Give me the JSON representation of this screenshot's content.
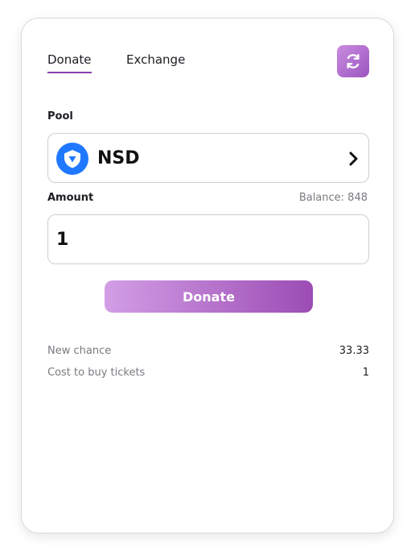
{
  "tabs": [
    {
      "label": "Donate",
      "active": true
    },
    {
      "label": "Exchange",
      "active": false
    }
  ],
  "header": {
    "refresh_icon": "refresh-icon"
  },
  "pool": {
    "label": "Pool",
    "selected_token": "NSD",
    "token_icon": "shield-token-icon",
    "token_icon_color": "#1f78ff"
  },
  "amount": {
    "label": "Amount",
    "balance_text": "Balance: 848",
    "value": "1"
  },
  "donate_button": {
    "label": "Donate"
  },
  "stats": [
    {
      "label": "New chance",
      "value": "33.33"
    },
    {
      "label": "Cost to buy tickets",
      "value": "1"
    }
  ],
  "colors": {
    "accent": "#8a3fae",
    "button_gradient_start": "#d39ee6",
    "button_gradient_end": "#9b4cb4"
  }
}
